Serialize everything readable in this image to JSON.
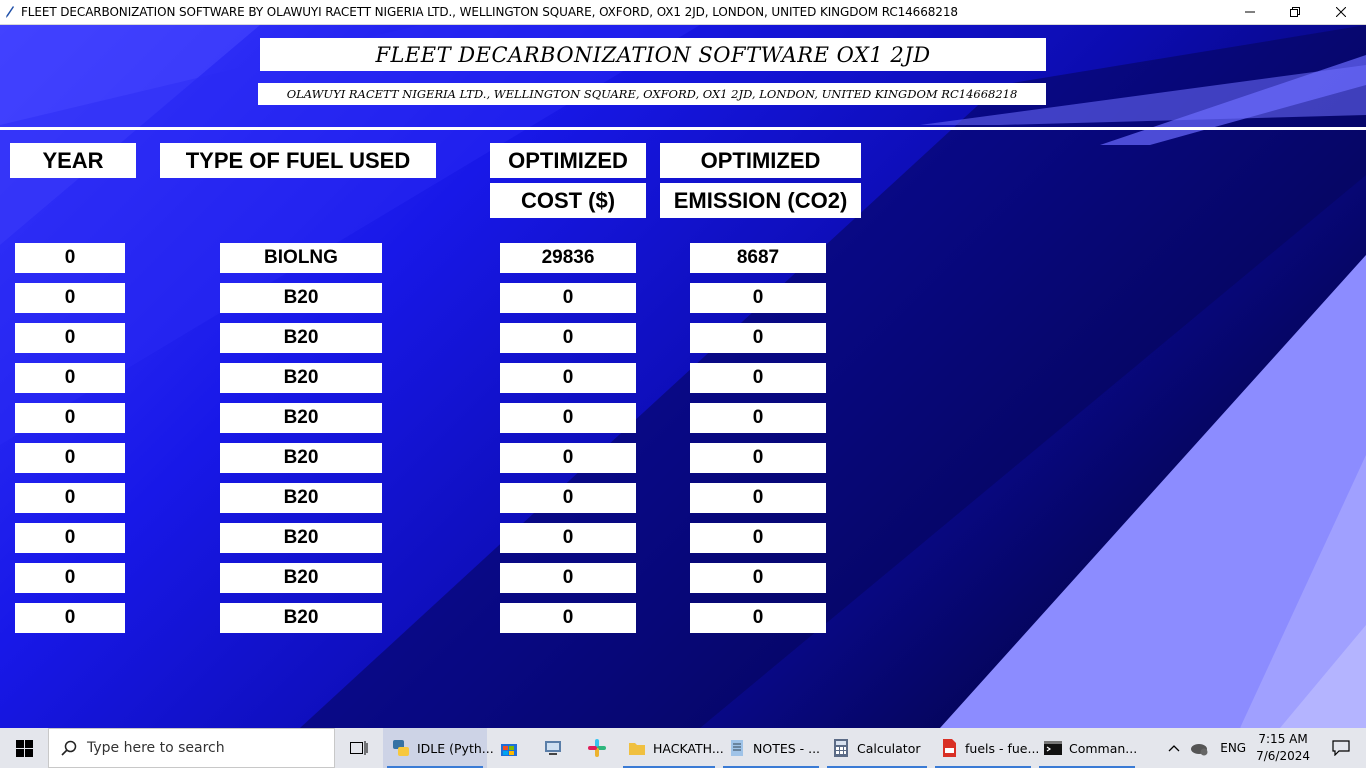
{
  "window": {
    "title": "FLEET DECARBONIZATION SOFTWARE BY OLAWUYI RACETT NIGERIA LTD., WELLINGTON SQUARE, OXFORD, OX1 2JD, LONDON, UNITED KINGDOM RC14668218",
    "controls": [
      "minimize-icon",
      "restore-icon",
      "close-icon"
    ]
  },
  "header": {
    "title": "FLEET DECARBONIZATION SOFTWARE OX1 2JD",
    "subtitle": "OLAWUYI RACETT NIGERIA LTD., WELLINGTON SQUARE, OXFORD, OX1 2JD, LONDON, UNITED KINGDOM RC14668218"
  },
  "table": {
    "headers": {
      "year": "YEAR",
      "fuel": "TYPE OF FUEL USED",
      "cost_line1": "OPTIMIZED",
      "cost_line2": "COST ($)",
      "emission_line1": "OPTIMIZED",
      "emission_line2": "EMISSION (CO2)"
    },
    "rows": [
      {
        "year": "0",
        "fuel": "BIOLNG",
        "cost": "29836",
        "emission": "8687"
      },
      {
        "year": "0",
        "fuel": "B20",
        "cost": "0",
        "emission": "0"
      },
      {
        "year": "0",
        "fuel": "B20",
        "cost": "0",
        "emission": "0"
      },
      {
        "year": "0",
        "fuel": "B20",
        "cost": "0",
        "emission": "0"
      },
      {
        "year": "0",
        "fuel": "B20",
        "cost": "0",
        "emission": "0"
      },
      {
        "year": "0",
        "fuel": "B20",
        "cost": "0",
        "emission": "0"
      },
      {
        "year": "0",
        "fuel": "B20",
        "cost": "0",
        "emission": "0"
      },
      {
        "year": "0",
        "fuel": "B20",
        "cost": "0",
        "emission": "0"
      },
      {
        "year": "0",
        "fuel": "B20",
        "cost": "0",
        "emission": "0"
      },
      {
        "year": "0",
        "fuel": "B20",
        "cost": "0",
        "emission": "0"
      }
    ]
  },
  "taskbar": {
    "search_placeholder": "Type here to search",
    "apps": [
      {
        "icon": "python-icon",
        "label": "IDLE (Pyth...",
        "active": true
      },
      {
        "icon": "store-icon",
        "label": ""
      },
      {
        "icon": "remote-desktop-icon",
        "label": ""
      },
      {
        "icon": "slack-icon",
        "label": ""
      },
      {
        "icon": "folder-icon",
        "label": "HACKATH..."
      },
      {
        "icon": "notepad-icon",
        "label": "NOTES - ..."
      },
      {
        "icon": "calculator-icon",
        "label": "Calculator"
      },
      {
        "icon": "pdf-icon",
        "label": "fuels - fue..."
      },
      {
        "icon": "terminal-icon",
        "label": "Comman..."
      }
    ],
    "tray": {
      "language": "ENG",
      "time": "7:15 AM",
      "date": "7/6/2024"
    }
  },
  "colors": {
    "bg_light": "#3a3aff",
    "bg_dark": "#040440",
    "stripe": "#8c8cff"
  }
}
